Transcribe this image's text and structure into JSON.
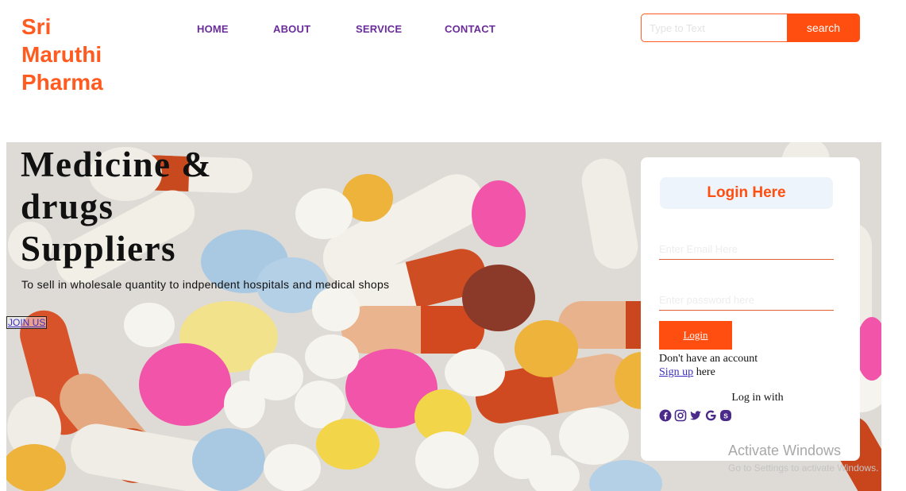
{
  "brand": {
    "name": "Sri Maruthi Pharma"
  },
  "nav": {
    "items": [
      {
        "label": "HOME"
      },
      {
        "label": "ABOUT"
      },
      {
        "label": "SERVICE"
      },
      {
        "label": "CONTACT"
      }
    ]
  },
  "search": {
    "placeholder": "Type to Text",
    "button_label": "search"
  },
  "hero": {
    "title": "Medicine & drugs Suppliers",
    "subtitle": "To sell in wholesale quantity to indpendent hospitals and medical shops",
    "join_label": "JOIN US"
  },
  "login": {
    "title": "Login Here",
    "email_placeholder": "Enter Email Here",
    "password_placeholder": "Enter password here",
    "button_label": "Login",
    "no_account_text": "Don't have an account",
    "signup_link": "Sign up",
    "signup_suffix": " here",
    "login_with_text": "Log in with",
    "social_icons": [
      "facebook-icon",
      "instagram-icon",
      "twitter-icon",
      "google-icon",
      "skype-icon"
    ]
  },
  "watermark": {
    "title": "Activate Windows",
    "subtitle": "Go to Settings to activate Windows."
  },
  "colors": {
    "accent": "#ff4e0f",
    "brand": "#ff5a1f",
    "nav": "#6a2c9a",
    "link": "#3a2ec0"
  }
}
